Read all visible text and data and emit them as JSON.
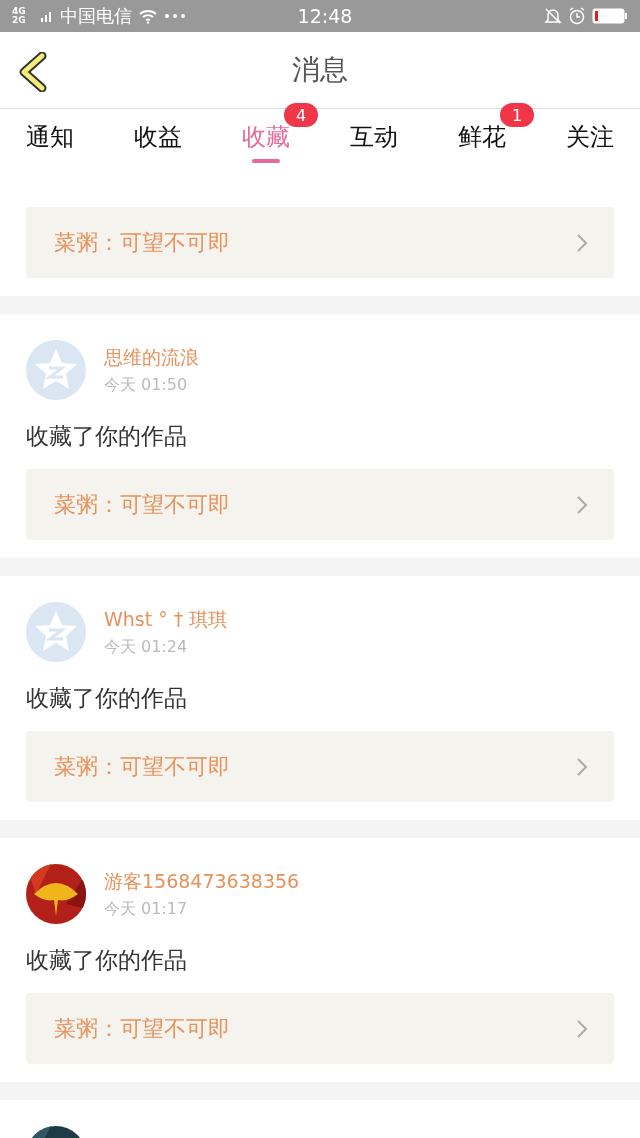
{
  "status_bar": {
    "network": "4G 2G",
    "carrier": "中国电信",
    "time": "12:48"
  },
  "header": {
    "title": "消息"
  },
  "tabs": [
    {
      "label": "通知",
      "selected": false
    },
    {
      "label": "收益",
      "selected": false
    },
    {
      "label": "收藏",
      "selected": true,
      "badge": "4"
    },
    {
      "label": "互动",
      "selected": false
    },
    {
      "label": "鲜花",
      "selected": false,
      "badge": "1"
    },
    {
      "label": "关注",
      "selected": false
    }
  ],
  "items": [
    {
      "work": "菜粥：可望不可即"
    },
    {
      "avatar": {
        "kind": "default"
      },
      "name": "思维的流浪",
      "time": "今天 01:50",
      "action": "收藏了你的作品",
      "work": "菜粥：可望不可即"
    },
    {
      "avatar": {
        "kind": "default"
      },
      "name": "Whst ° † 琪琪",
      "time": "今天 01:24",
      "action": "收藏了你的作品",
      "work": "菜粥：可望不可即"
    },
    {
      "avatar": {
        "kind": "picture"
      },
      "name": "游客1568473638356",
      "time": "今天 01:17",
      "action": "收藏了你的作品",
      "work": "菜粥：可望不可即"
    },
    {
      "avatar": {
        "kind": "picture"
      }
    }
  ]
}
